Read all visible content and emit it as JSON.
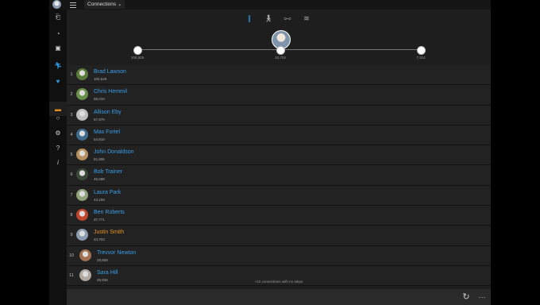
{
  "topbar": {
    "title": "Connections"
  },
  "sidebar": {
    "icons": [
      "dashboard-icon",
      "calendar-icon",
      "inbox-icon",
      "activity-icon",
      "heart-icon",
      "connections-icon",
      "watch-icon",
      "settings-icon",
      "help-icon",
      "info-icon"
    ]
  },
  "tabs": [
    {
      "name": "steps",
      "icon": "footsteps-icon",
      "active": true
    },
    {
      "name": "running",
      "icon": "runner-icon",
      "active": false
    },
    {
      "name": "cycling",
      "icon": "bike-icon",
      "active": false
    },
    {
      "name": "swimming",
      "icon": "swimmer-icon",
      "active": false
    }
  ],
  "scale": {
    "left": {
      "rank": "1",
      "value": "100,529"
    },
    "mid": {
      "rank": "9",
      "value": "33,703"
    },
    "right": {
      "rank": "11",
      "value": "7,314"
    }
  },
  "rows": [
    {
      "rank": "1",
      "name": "Brad Lawson",
      "steps": "100,529"
    },
    {
      "rank": "2",
      "name": "Chris Hemmil",
      "steps": "58,010"
    },
    {
      "rank": "3",
      "name": "Allison Eby",
      "steps": "57,870"
    },
    {
      "rank": "4",
      "name": "Max Fortel",
      "steps": "54,810"
    },
    {
      "rank": "5",
      "name": "John Donaldson",
      "steps": "51,806"
    },
    {
      "rank": "6",
      "name": "Bob Trainer",
      "steps": "46,088"
    },
    {
      "rank": "7",
      "name": "Laura Park",
      "steps": "43,159"
    },
    {
      "rank": "8",
      "name": "Ben Roberts",
      "steps": "37,771"
    },
    {
      "rank": "9",
      "name": "Justin Smith",
      "steps": "33,703"
    },
    {
      "rank": "10",
      "name": "Trevvor Newton",
      "steps": "29,808"
    },
    {
      "rank": "11",
      "name": "Sara Hill",
      "steps": "28,836"
    }
  ],
  "footer": {
    "note": "+12 connections with no steps"
  },
  "colors": {
    "accent": "#2e9be6",
    "highlight": "#e6951e"
  }
}
